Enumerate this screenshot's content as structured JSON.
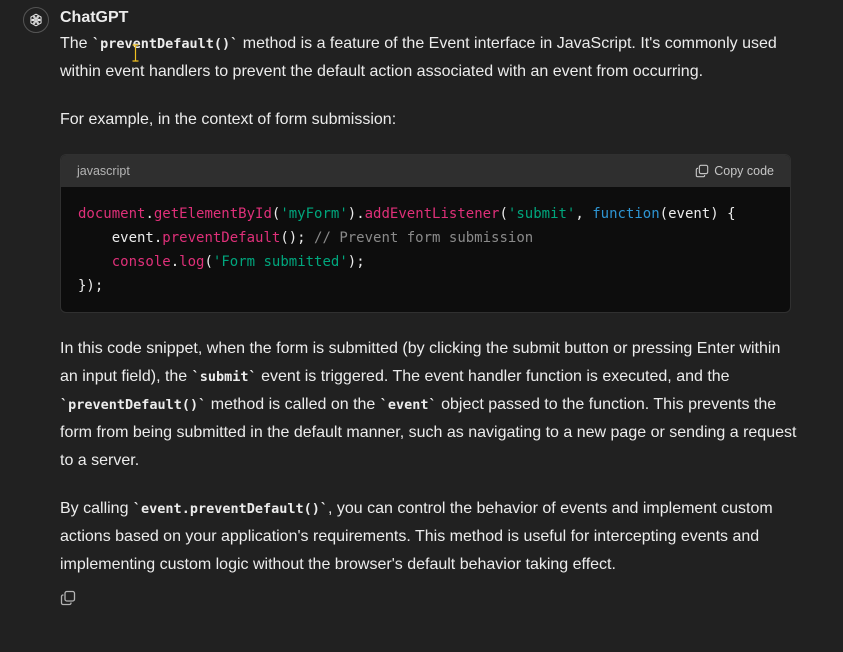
{
  "message": {
    "author": "ChatGPT",
    "avatar_icon": "openai-logo-icon",
    "paragraphs": {
      "p1": {
        "t1": "The ",
        "c1": "`preventDefault()`",
        "t2": " method is a feature of the Event interface in JavaScript. It's commonly used within event handlers to prevent the default action associated with an event from occurring."
      },
      "p2": {
        "t1": "For example, in the context of form submission:"
      },
      "p3": {
        "t1": "In this code snippet, when the form is submitted (by clicking the submit button or pressing Enter within an input field), the ",
        "c1": "`submit`",
        "t2": " event is triggered. The event handler function is executed, and the ",
        "c2": "`preventDefault()`",
        "t3": " method is called on the ",
        "c3": "`event`",
        "t4": " object passed to the function. This prevents the form from being submitted in the default manner, such as navigating to a new page or sending a request to a server."
      },
      "p4": {
        "t1": "By calling ",
        "c1": "`event.preventDefault()`",
        "t2": ", you can control the behavior of events and implement custom actions based on your application's requirements. This method is useful for intercepting events and implementing custom logic without the browser's default behavior taking effect."
      }
    },
    "code_block": {
      "language": "javascript",
      "copy_label": "Copy code",
      "copy_icon": "copy-icon",
      "lines": [
        [
          {
            "t": "document",
            "k": "obj"
          },
          {
            "t": ".",
            "k": "pl"
          },
          {
            "t": "getElementById",
            "k": "fn"
          },
          {
            "t": "(",
            "k": "pl"
          },
          {
            "t": "'myForm'",
            "k": "str"
          },
          {
            "t": ").",
            "k": "pl"
          },
          {
            "t": "addEventListener",
            "k": "fn"
          },
          {
            "t": "(",
            "k": "pl"
          },
          {
            "t": "'submit'",
            "k": "str"
          },
          {
            "t": ", ",
            "k": "pl"
          },
          {
            "t": "function",
            "k": "kw"
          },
          {
            "t": "(event) {",
            "k": "pl"
          }
        ],
        [
          {
            "t": "    event.",
            "k": "pl"
          },
          {
            "t": "preventDefault",
            "k": "fn"
          },
          {
            "t": "(); ",
            "k": "pl"
          },
          {
            "t": "// Prevent form submission",
            "k": "cm"
          }
        ],
        [
          {
            "t": "    ",
            "k": "pl"
          },
          {
            "t": "console",
            "k": "obj"
          },
          {
            "t": ".",
            "k": "pl"
          },
          {
            "t": "log",
            "k": "fn"
          },
          {
            "t": "(",
            "k": "pl"
          },
          {
            "t": "'Form submitted'",
            "k": "str"
          },
          {
            "t": ");",
            "k": "pl"
          }
        ],
        [
          {
            "t": "});",
            "k": "pl"
          }
        ]
      ]
    },
    "actions": {
      "copy_icon": "copy-icon"
    }
  }
}
